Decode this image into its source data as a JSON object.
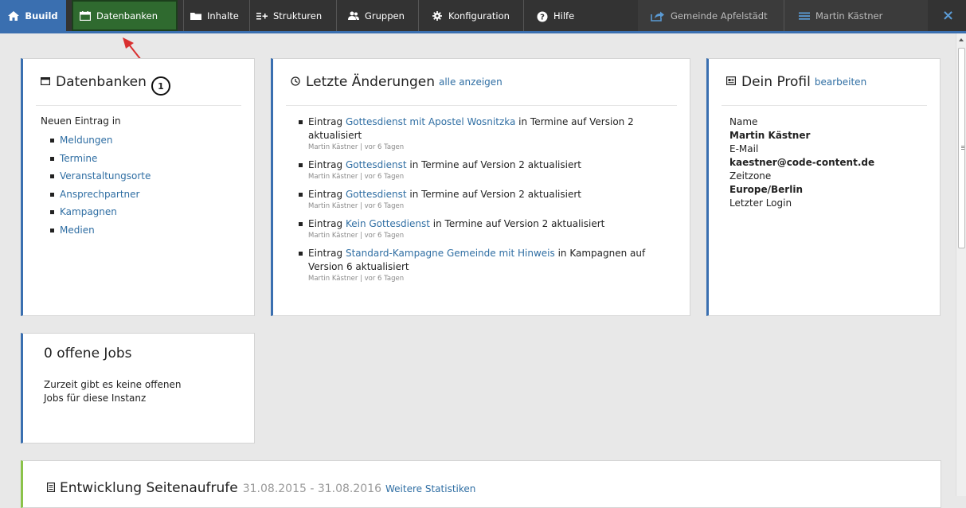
{
  "nav": {
    "brand": "Buuild",
    "items": [
      {
        "label": "Datenbanken",
        "icon": "calendar-icon"
      },
      {
        "label": "Inhalte",
        "icon": "folder-icon"
      },
      {
        "label": "Strukturen",
        "icon": "list-add-icon"
      },
      {
        "label": "Gruppen",
        "icon": "users-icon"
      },
      {
        "label": "Konfiguration",
        "icon": "gear-icon"
      },
      {
        "label": "Hilfe",
        "icon": "help-icon"
      }
    ],
    "site": "Gemeinde Apfelstädt",
    "user": "Martin Kästner",
    "close": "×",
    "accent_color": "#3a6fb0",
    "highlight_color": "#2f6a2f"
  },
  "annotation": {
    "number": "1",
    "arrow_color": "#d93030"
  },
  "databases": {
    "title": "Datenbanken",
    "intro": "Neuen Eintrag in",
    "items": [
      "Meldungen",
      "Termine",
      "Veranstaltungsorte",
      "Ansprechpartner",
      "Kampagnen",
      "Medien"
    ]
  },
  "changes": {
    "title": "Letzte Änderungen",
    "link": "alle anzeigen",
    "items": [
      {
        "pre": "Eintrag ",
        "link": "Gottesdienst mit Apostel Wosnitzka",
        "post": " in Termine auf Version 2 aktualisiert",
        "meta": "Martin Kästner | vor 6 Tagen"
      },
      {
        "pre": "Eintrag ",
        "link": "Gottesdienst",
        "post": " in Termine auf Version 2 aktualisiert",
        "meta": "Martin Kästner | vor 6 Tagen"
      },
      {
        "pre": "Eintrag ",
        "link": "Gottesdienst",
        "post": " in Termine auf Version 2 aktualisiert",
        "meta": "Martin Kästner | vor 6 Tagen"
      },
      {
        "pre": "Eintrag ",
        "link": "Kein Gottesdienst",
        "post": " in Termine auf Version 2 aktualisiert",
        "meta": "Martin Kästner | vor 6 Tagen"
      },
      {
        "pre": "Eintrag ",
        "link": "Standard-Kampagne Gemeinde mit Hinweis",
        "post": " in Kampagnen auf Version 6 aktualisiert",
        "meta": "Martin Kästner | vor 6 Tagen"
      }
    ]
  },
  "profile": {
    "title": "Dein Profil",
    "edit": "bearbeiten",
    "name_label": "Name",
    "name": "Martin Kästner",
    "email_label": "E-Mail",
    "email": "kaestner@code-content.de",
    "tz_label": "Zeitzone",
    "tz": "Europe/Berlin",
    "login_label": "Letzter Login"
  },
  "jobs": {
    "title": "0 offene Jobs",
    "text": "Zurzeit gibt es keine offenen Jobs für diese Instanz"
  },
  "stats": {
    "title": "Entwicklung Seitenaufrufe",
    "range": "31.08.2015 - 31.08.2016",
    "link": "Weitere Statistiken"
  }
}
